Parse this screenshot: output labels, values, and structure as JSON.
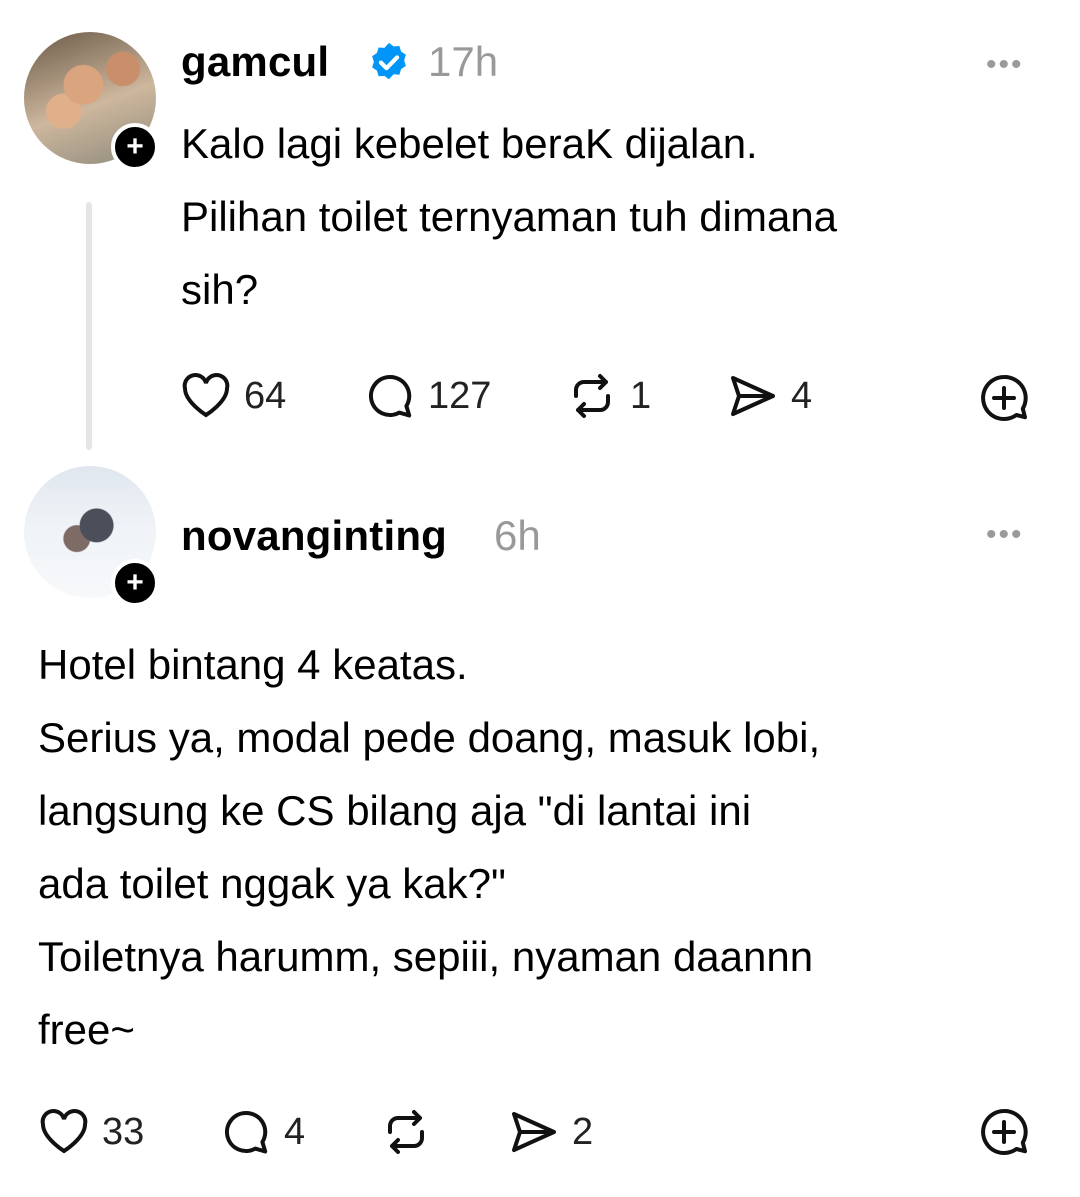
{
  "posts": [
    {
      "username": "gamcul",
      "verified": true,
      "time": "17h",
      "text_lines": [
        "Kalo lagi kebelet beraK dijalan.",
        "Pilihan toilet ternyaman tuh dimana",
        "sih?"
      ],
      "actions": {
        "likes": "64",
        "replies": "127",
        "reposts": "1",
        "shares": "4"
      }
    },
    {
      "username": "novanginting",
      "verified": false,
      "time": "6h",
      "text_lines": [
        "Hotel bintang 4 keatas.",
        "Serius ya, modal pede doang, masuk lobi,",
        "langsung ke CS bilang aja \"di lantai ini",
        "ada toilet nggak ya kak?\"",
        "Toiletnya harumm, sepiii, nyaman daannn",
        "free~"
      ],
      "actions": {
        "likes": "33",
        "replies": "4",
        "reposts": "",
        "shares": "2"
      }
    }
  ],
  "more_label": "•••",
  "plus_label": "+",
  "colors": {
    "verified": "#0095f6",
    "muted": "#999999",
    "text": "#000000"
  },
  "icons": [
    "heart-icon",
    "comment-icon",
    "repost-icon",
    "share-icon",
    "add-quote-icon",
    "verified-badge-icon",
    "more-icon"
  ]
}
